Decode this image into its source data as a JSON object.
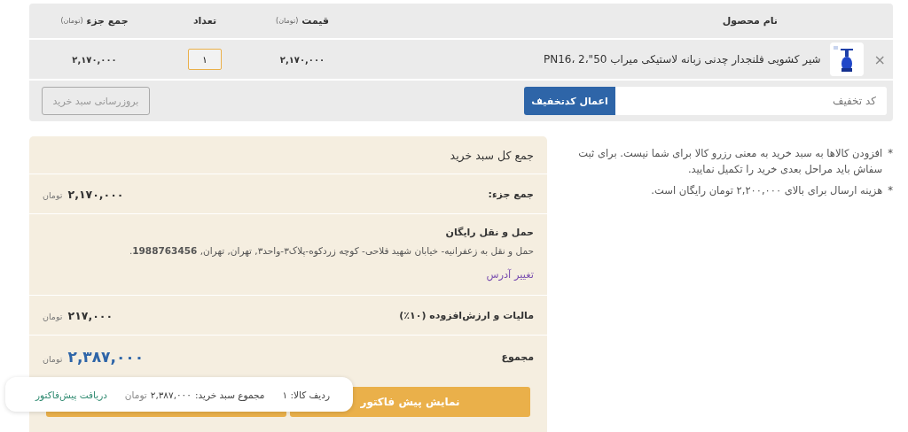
{
  "cart_table": {
    "columns": [
      {
        "label": "نام محصول"
      },
      {
        "label": "قیمت",
        "unit": "(تومان)"
      },
      {
        "label": "تعداد"
      },
      {
        "label": "جمع جزء",
        "unit": "(تومان)"
      }
    ],
    "rows": [
      {
        "remove": "×",
        "name": "شیر کشویی فلنجدار چدنی زبانه لاستیکی میراب 50\"،2 ،PN16",
        "price": "۲,۱۷۰,۰۰۰",
        "quantity": "۱",
        "subtotal": "۲,۱۷۰,۰۰۰"
      }
    ],
    "coupon": {
      "placeholder": "کد تخفیف",
      "button": "اعمال کدتخفیف"
    },
    "update_button": {
      "label": "بروزرسانی سبد خرید",
      "disabled": true
    }
  },
  "totals": {
    "title": "جمع کل سبد خرید",
    "subtotal": {
      "label": "جمع جزء:",
      "value": "۲,۱۷۰,۰۰۰",
      "currency": "تومان"
    },
    "shipping": {
      "title": "حمل و نقل رایگان",
      "address": "حمل و نقل به زعفرانیه- خیابان شهید فلاحی- کوچه زردکوه-پلاک۳-واحد۳, تهران, تهران, **1988763456**.",
      "change_link": "تغییر آدرس"
    },
    "tax": {
      "label": "مالیات و ارزش‌افزوده (۱۰٪)",
      "value": "۲۱۷,۰۰۰",
      "currency": "تومان"
    },
    "total": {
      "label": "مجموع",
      "value": "۲,۳۸۷,۰۰۰",
      "currency": "تومان"
    },
    "buttons": [
      {
        "kind": "primary",
        "label": "نمایش پیش فاکتور"
      },
      {
        "kind": "covered"
      }
    ]
  },
  "notes": [
    "افزودن کالاها به سبد خرید به معنی رزرو کالا برای شما نیست. برای ثبت سفاش باید مراحل بعدی خرید را تکمیل نمایید.",
    "هزینه ارسال برای بالای ۲,۲۰۰,۰۰۰ تومان رایگان است."
  ],
  "note_marker": "*",
  "popup": {
    "row_count": "ردیف کالا: ۱",
    "cart_total_label": "مجموع سبد خرید:",
    "cart_total_value": "۲,۳۸۷,۰۰۰",
    "currency": "تومان",
    "link": "دریافت پیش‌فاکتور"
  }
}
